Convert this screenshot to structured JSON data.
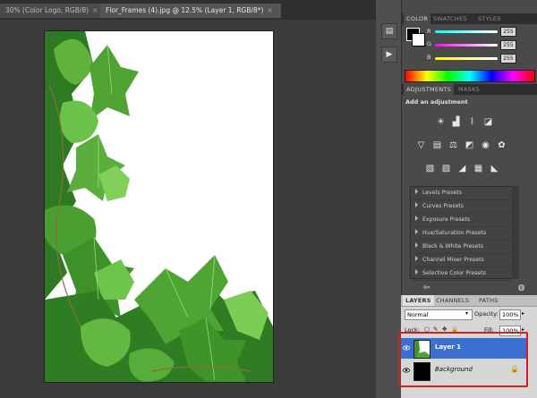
{
  "document_tabs": [
    {
      "label": "30% (Color Logo, RGB/8)",
      "close": "×"
    },
    {
      "label": "Flor_Frames (4).jpg @ 12.5% (Layer 1, RGB/8*)",
      "close": "×"
    }
  ],
  "color_panel": {
    "tabs": [
      "COLOR",
      "SWATCHES",
      "STYLES"
    ],
    "channels": [
      {
        "label": "R",
        "value": "255",
        "color": "#d85a5a"
      },
      {
        "label": "G",
        "value": "255",
        "color": "#5ac06a"
      },
      {
        "label": "B",
        "value": "255",
        "color": "#5a8ad8"
      }
    ]
  },
  "adjustments_panel": {
    "tabs": [
      "ADJUSTMENTS",
      "MASKS"
    ],
    "heading": "Add an adjustment",
    "presets": [
      "Levels Presets",
      "Curves Presets",
      "Exposure Presets",
      "Hue/Saturation Presets",
      "Black & White Presets",
      "Channel Mixer Presets",
      "Selective Color Presets"
    ]
  },
  "layers_panel": {
    "tabs": [
      "LAYERS",
      "CHANNELS",
      "PATHS"
    ],
    "blend_mode": "Normal",
    "opacity_label": "Opacity:",
    "opacity_value": "100%",
    "lock_label": "Lock:",
    "fill_label": "Fill:",
    "fill_value": "100%",
    "layers": [
      {
        "name": "Layer 1",
        "selected": true
      },
      {
        "name": "Background",
        "selected": false,
        "locked": true
      }
    ]
  },
  "colors": {
    "accent_selected_layer": "#3b6fd0",
    "highlight_box": "#d32020"
  }
}
